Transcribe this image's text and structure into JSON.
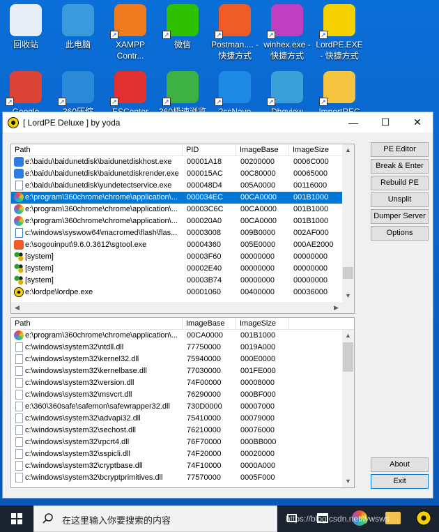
{
  "desktop": {
    "icons": [
      {
        "label": "回收站",
        "color": "#e8eef5"
      },
      {
        "label": "此电脑",
        "color": "#3a9bdc"
      },
      {
        "label": "XAMPP Contr...",
        "color": "#f07b1e"
      },
      {
        "label": "微信",
        "color": "#2dc100"
      },
      {
        "label": "Postman.... - 快捷方式",
        "color": "#ef5b25"
      },
      {
        "label": "winhex.exe - 快捷方式",
        "color": "#c03fc0"
      },
      {
        "label": "LordPE.EXE - 快捷方式",
        "color": "#f5d000"
      },
      {
        "label": "Google",
        "color": "#db4437"
      },
      {
        "label": "360压缩",
        "color": "#2b8ad8"
      },
      {
        "label": "ESCeptor",
        "color": "#e03030"
      },
      {
        "label": "360极速浏览",
        "color": "#3cb043"
      },
      {
        "label": "2ssNavo",
        "color": "#1e88e5"
      },
      {
        "label": "Dbgview",
        "color": "#3aa0d8"
      },
      {
        "label": "ImportREC",
        "color": "#f5c542"
      }
    ]
  },
  "window": {
    "title": "[ LordPE Deluxe ] by yoda",
    "controls": {
      "minimize": "—",
      "maximize": "☐",
      "close": "✕"
    }
  },
  "process_list": {
    "headers": [
      "Path",
      "PID",
      "ImageBase",
      "ImageSize"
    ],
    "selected_index": 3,
    "rows": [
      {
        "path": "e:\\baidu\\baidunetdisk\\baidunetdiskhost.exe",
        "pid": "00001A18",
        "base": "00200000",
        "size": "0006C000",
        "icon": "baidu-icon",
        "color": "#2d7be5"
      },
      {
        "path": "e:\\baidu\\baidunetdisk\\baidunetdiskrender.exe",
        "pid": "000015AC",
        "base": "00C80000",
        "size": "00065000",
        "icon": "baidu-icon",
        "color": "#2d7be5"
      },
      {
        "path": "e:\\baidu\\baidunetdisk\\yundetectservice.exe",
        "pid": "000048D4",
        "base": "005A0000",
        "size": "00116000",
        "icon": "exe-icon",
        "color": "#7a8aa0"
      },
      {
        "path": "e:\\program\\360chrome\\chrome\\application\\...",
        "pid": "000034EC",
        "base": "00CA0000",
        "size": "001B1000",
        "icon": "chrome360-icon",
        "color": "#e8a000"
      },
      {
        "path": "e:\\program\\360chrome\\chrome\\application\\...",
        "pid": "00003C6C",
        "base": "00CA0000",
        "size": "001B1000",
        "icon": "chrome360-icon",
        "color": "#e8a000"
      },
      {
        "path": "e:\\program\\360chrome\\chrome\\application\\...",
        "pid": "000020A0",
        "base": "00CA0000",
        "size": "001B1000",
        "icon": "chrome360-icon",
        "color": "#e8a000"
      },
      {
        "path": "c:\\windows\\syswow64\\macromed\\flash\\flas...",
        "pid": "00003008",
        "base": "009B0000",
        "size": "002AF000",
        "icon": "exe-icon",
        "color": "#3a7bd5"
      },
      {
        "path": "e:\\sogouinput\\9.6.0.3612\\sgtool.exe",
        "pid": "00004360",
        "base": "005E0000",
        "size": "000AE2000",
        "icon": "sogou-icon",
        "color": "#f05a28"
      },
      {
        "path": "[system]",
        "pid": "00003F60",
        "base": "00000000",
        "size": "00000000",
        "icon": "system-icon",
        "color": "#2aa02a"
      },
      {
        "path": "[system]",
        "pid": "00002E40",
        "base": "00000000",
        "size": "00000000",
        "icon": "system-icon",
        "color": "#2aa02a"
      },
      {
        "path": "[system]",
        "pid": "00003B74",
        "base": "00000000",
        "size": "00000000",
        "icon": "system-icon",
        "color": "#2aa02a"
      },
      {
        "path": "e:\\lordpe\\lordpe.exe",
        "pid": "00001060",
        "base": "00400000",
        "size": "00036000",
        "icon": "lordpe-icon",
        "color": "#f5d000"
      }
    ]
  },
  "module_list": {
    "headers": [
      "Path",
      "ImageBase",
      "ImageSize"
    ],
    "rows": [
      {
        "path": "e:\\program\\360chrome\\chrome\\application\\...",
        "base": "00CA0000",
        "size": "001B1000",
        "icon": "chrome360-icon",
        "color": "#e8a000"
      },
      {
        "path": "c:\\windows\\system32\\ntdll.dll",
        "base": "77750000",
        "size": "0019A000",
        "icon": "dll-icon",
        "color": "#9aa4b0"
      },
      {
        "path": "c:\\windows\\system32\\kernel32.dll",
        "base": "75940000",
        "size": "000E0000",
        "icon": "dll-icon",
        "color": "#9aa4b0"
      },
      {
        "path": "c:\\windows\\system32\\kernelbase.dll",
        "base": "77030000",
        "size": "001FE000",
        "icon": "dll-icon",
        "color": "#9aa4b0"
      },
      {
        "path": "c:\\windows\\system32\\version.dll",
        "base": "74F00000",
        "size": "00008000",
        "icon": "dll-icon",
        "color": "#9aa4b0"
      },
      {
        "path": "c:\\windows\\system32\\msvcrt.dll",
        "base": "76290000",
        "size": "000BF000",
        "icon": "dll-icon",
        "color": "#9aa4b0"
      },
      {
        "path": "e:\\360\\360safe\\safemon\\safewrapper32.dll",
        "base": "730D0000",
        "size": "00007000",
        "icon": "dll-icon",
        "color": "#9aa4b0"
      },
      {
        "path": "c:\\windows\\system32\\advapi32.dll",
        "base": "75410000",
        "size": "00079000",
        "icon": "dll-icon",
        "color": "#9aa4b0"
      },
      {
        "path": "c:\\windows\\system32\\sechost.dll",
        "base": "76210000",
        "size": "00076000",
        "icon": "dll-icon",
        "color": "#9aa4b0"
      },
      {
        "path": "c:\\windows\\system32\\rpcrt4.dll",
        "base": "76F70000",
        "size": "000BB000",
        "icon": "dll-icon",
        "color": "#9aa4b0"
      },
      {
        "path": "c:\\windows\\system32\\sspicli.dll",
        "base": "74F20000",
        "size": "00020000",
        "icon": "dll-icon",
        "color": "#9aa4b0"
      },
      {
        "path": "c:\\windows\\system32\\cryptbase.dll",
        "base": "74F10000",
        "size": "0000A000",
        "icon": "dll-icon",
        "color": "#9aa4b0"
      },
      {
        "path": "c:\\windows\\system32\\bcryptprimitives.dll",
        "base": "77570000",
        "size": "0005F000",
        "icon": "dll-icon",
        "color": "#9aa4b0"
      }
    ]
  },
  "buttons": {
    "pe_editor": "PE Editor",
    "break_enter": "Break & Enter",
    "rebuild_pe": "Rebuild PE",
    "unsplit": "Unsplit",
    "dumper_server": "Dumper Server",
    "options": "Options",
    "about": "About",
    "exit": "Exit"
  },
  "taskbar": {
    "search_placeholder": "在这里输入你要搜索的内容",
    "watermark": "https://blog.csdn.net/lywsws"
  }
}
